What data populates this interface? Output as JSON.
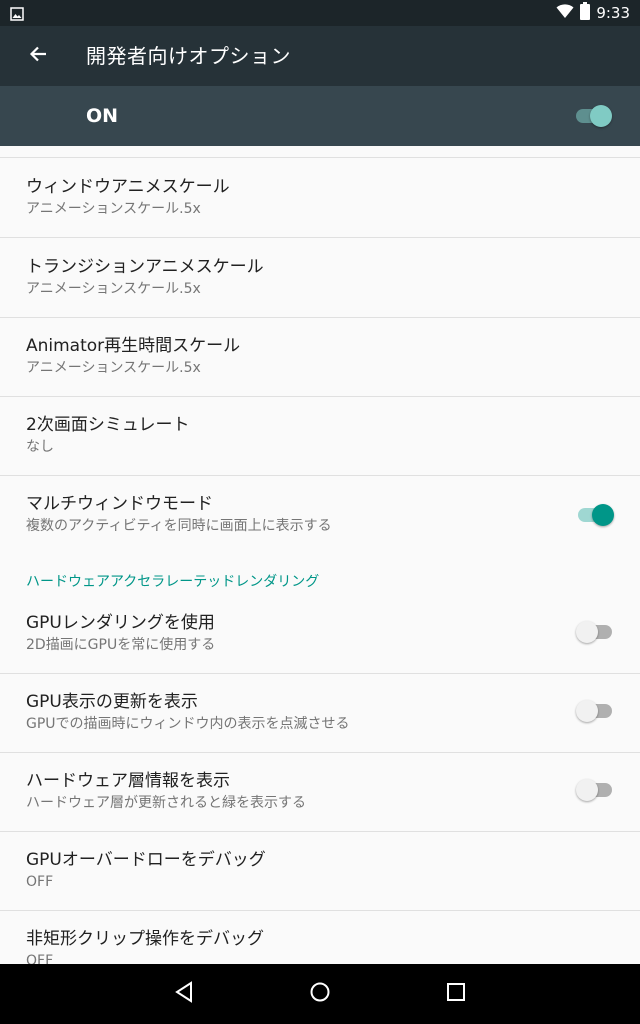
{
  "status_bar": {
    "time": "9:33",
    "icons": [
      "image-notification-icon",
      "wifi-icon",
      "battery-icon"
    ]
  },
  "toolbar": {
    "back_icon": "arrow-back-icon",
    "title": "開発者向けオプション"
  },
  "master_switch": {
    "label": "ON",
    "checked": true
  },
  "settings": [
    {
      "title": "ウィンドウアニメスケール",
      "summary": "アニメーションスケール.5x"
    },
    {
      "title": "トランジションアニメスケール",
      "summary": "アニメーションスケール.5x"
    },
    {
      "title": "Animator再生時間スケール",
      "summary": "アニメーションスケール.5x"
    },
    {
      "title": "2次画面シミュレート",
      "summary": "なし"
    },
    {
      "title": "マルチウィンドウモード",
      "summary": "複数のアクティビティを同時に画面上に表示する",
      "toggle": true,
      "checked": true
    }
  ],
  "category": {
    "label": "ハードウェアアクセラレーテッドレンダリング"
  },
  "hw_settings": [
    {
      "title": "GPUレンダリングを使用",
      "summary": "2D描画にGPUを常に使用する",
      "toggle": true,
      "checked": false
    },
    {
      "title": "GPU表示の更新を表示",
      "summary": "GPUでの描画時にウィンドウ内の表示を点滅させる",
      "toggle": true,
      "checked": false
    },
    {
      "title": "ハードウェア層情報を表示",
      "summary": "ハードウェア層が更新されると緑を表示する",
      "toggle": true,
      "checked": false
    },
    {
      "title": "GPUオーバードローをデバッグ",
      "summary": "OFF"
    },
    {
      "title": "非矩形クリップ操作をデバッグ",
      "summary": "OFF"
    }
  ],
  "navigation_bar": {
    "icons": [
      "nav-back-icon",
      "nav-home-icon",
      "nav-recents-icon"
    ]
  },
  "colors": {
    "toolbar": "#263238",
    "master_bar": "#37474f",
    "accent": "#009688",
    "background": "#fafafa"
  }
}
